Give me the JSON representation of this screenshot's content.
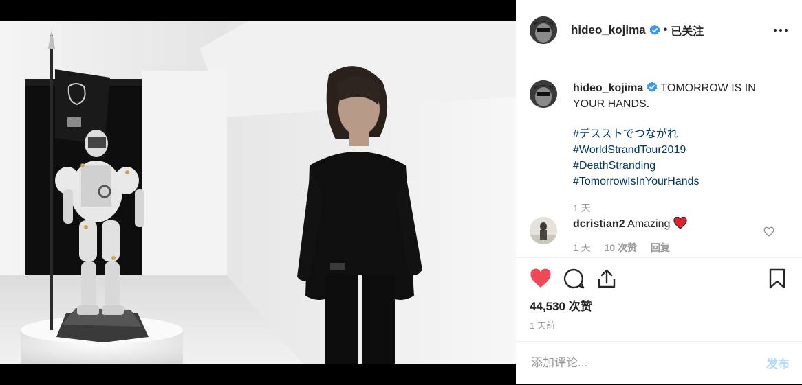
{
  "post": {
    "image_alt": "Norman Reedus standing beside a Ludens statue holding a black flag in a white room"
  },
  "header": {
    "username": "hideo_kojima",
    "separator": "•",
    "follow_label": "已关注"
  },
  "caption": {
    "username": "hideo_kojima",
    "text": "TOMORROW IS IN YOUR HANDS.",
    "hashtags": [
      "#デススト​でつながれ",
      "#WorldStrandTour2019",
      "#DeathStranding",
      "#TomorrowIsInYourHands"
    ],
    "time": "1 天"
  },
  "reply": {
    "username": "dcristian2",
    "text": "Amazing",
    "time": "1 天",
    "likes": "10 次赞",
    "reply_label": "回复"
  },
  "stats": {
    "likes": "44,530 次赞",
    "time_ago": "1 天前"
  },
  "comment_box": {
    "placeholder": "添加评论...",
    "post_label": "发布"
  },
  "colors": {
    "like_red": "#ed4956",
    "link_blue": "#003569",
    "verified_blue": "#3897f0",
    "post_disabled": "#b2dffc"
  },
  "icons": {
    "like": "heart-filled-icon",
    "comment": "comment-bubble-icon",
    "share": "share-upload-icon",
    "save": "bookmark-icon",
    "more": "more-dots-icon",
    "verified": "verified-badge-icon",
    "reply_like": "heart-outline-icon"
  }
}
